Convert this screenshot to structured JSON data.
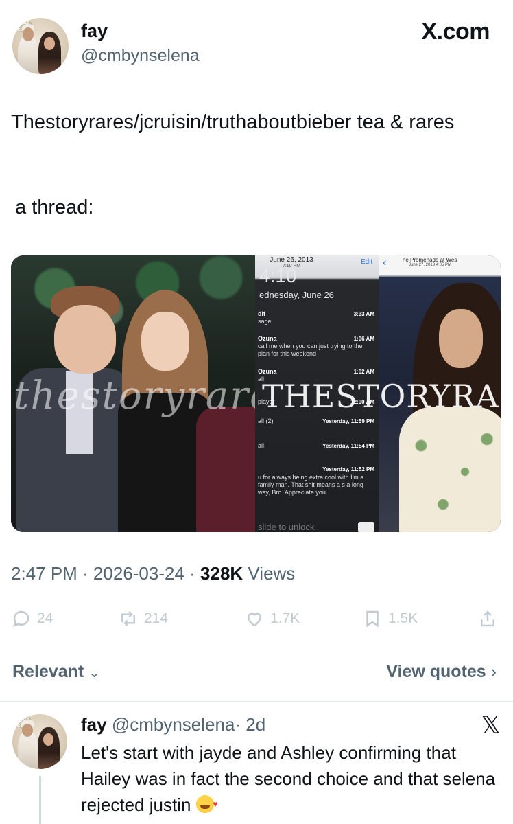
{
  "post": {
    "author_name": "fay",
    "author_handle": "@cmbynselena",
    "source_label": "X.com",
    "text": "Thestoryrares/jcruisin/truthaboutbieber tea & rares",
    "text_line2": "a thread:",
    "timestamp": "2:47 PM · 2026-03-24 · ",
    "views_count": "328K",
    "views_label": " Views",
    "avatar_badge_text": "SELLS GOMEZ"
  },
  "media": {
    "watermark_script": "thestoryrare",
    "watermark_caps": "THESTORYRARE",
    "lockscreen": {
      "date": "June 26, 2013",
      "date_time": "7:10 PM",
      "edit_label": "Edit",
      "clock": "4:10",
      "weekday": "ednesday, June 26",
      "notifications": [
        {
          "title": "dit",
          "body": "sage",
          "time": "3:33 AM"
        },
        {
          "title": "Ozuna",
          "body": "call me when you can just trying to the plan for this weekend",
          "time": "1:06 AM"
        },
        {
          "title": "Ozuna",
          "body": "all",
          "time": "1:02 AM"
        },
        {
          "title": "",
          "body": "player",
          "time": "12:00 AM"
        },
        {
          "title": "",
          "body": "all (2)",
          "time": "Yesterday, 11:59 PM"
        },
        {
          "title": "",
          "body": "all",
          "time": "Yesterday, 11:54 PM"
        },
        {
          "title": "",
          "body": "u for always being extra cool with I'm a family man. That shit means a s a long way, Bro. Appreciate you.",
          "time": "Yesterday, 11:52 PM"
        }
      ],
      "slide_text": "slide to unlock"
    },
    "photo3": {
      "location": "The Promenade at Wes",
      "date": "June 27, 2013 4:05 PM"
    }
  },
  "actions": [
    {
      "name": "reply",
      "icon": "reply-icon",
      "count": "24"
    },
    {
      "name": "retweet",
      "icon": "retweet-icon",
      "count": "214"
    },
    {
      "name": "like",
      "icon": "heart-icon",
      "count": "1.7K"
    },
    {
      "name": "bookmark",
      "icon": "bookmark-icon",
      "count": "1.5K"
    },
    {
      "name": "share",
      "icon": "share-icon",
      "count": ""
    }
  ],
  "replies_bar": {
    "sort_label": "Relevant",
    "view_quotes_label": "View quotes"
  },
  "reply": {
    "author_name": "fay",
    "author_handle": "@cmbynselena",
    "age": "· 2d",
    "text": "Let's start with jayde and Ashley confirming that Hailey was in fact the second choice and that selena rejected justin"
  },
  "colors": {
    "text_primary": "#0f1419",
    "text_secondary": "#536471",
    "action_icon": "#c3cbd2",
    "divider": "#e1e6ea"
  }
}
